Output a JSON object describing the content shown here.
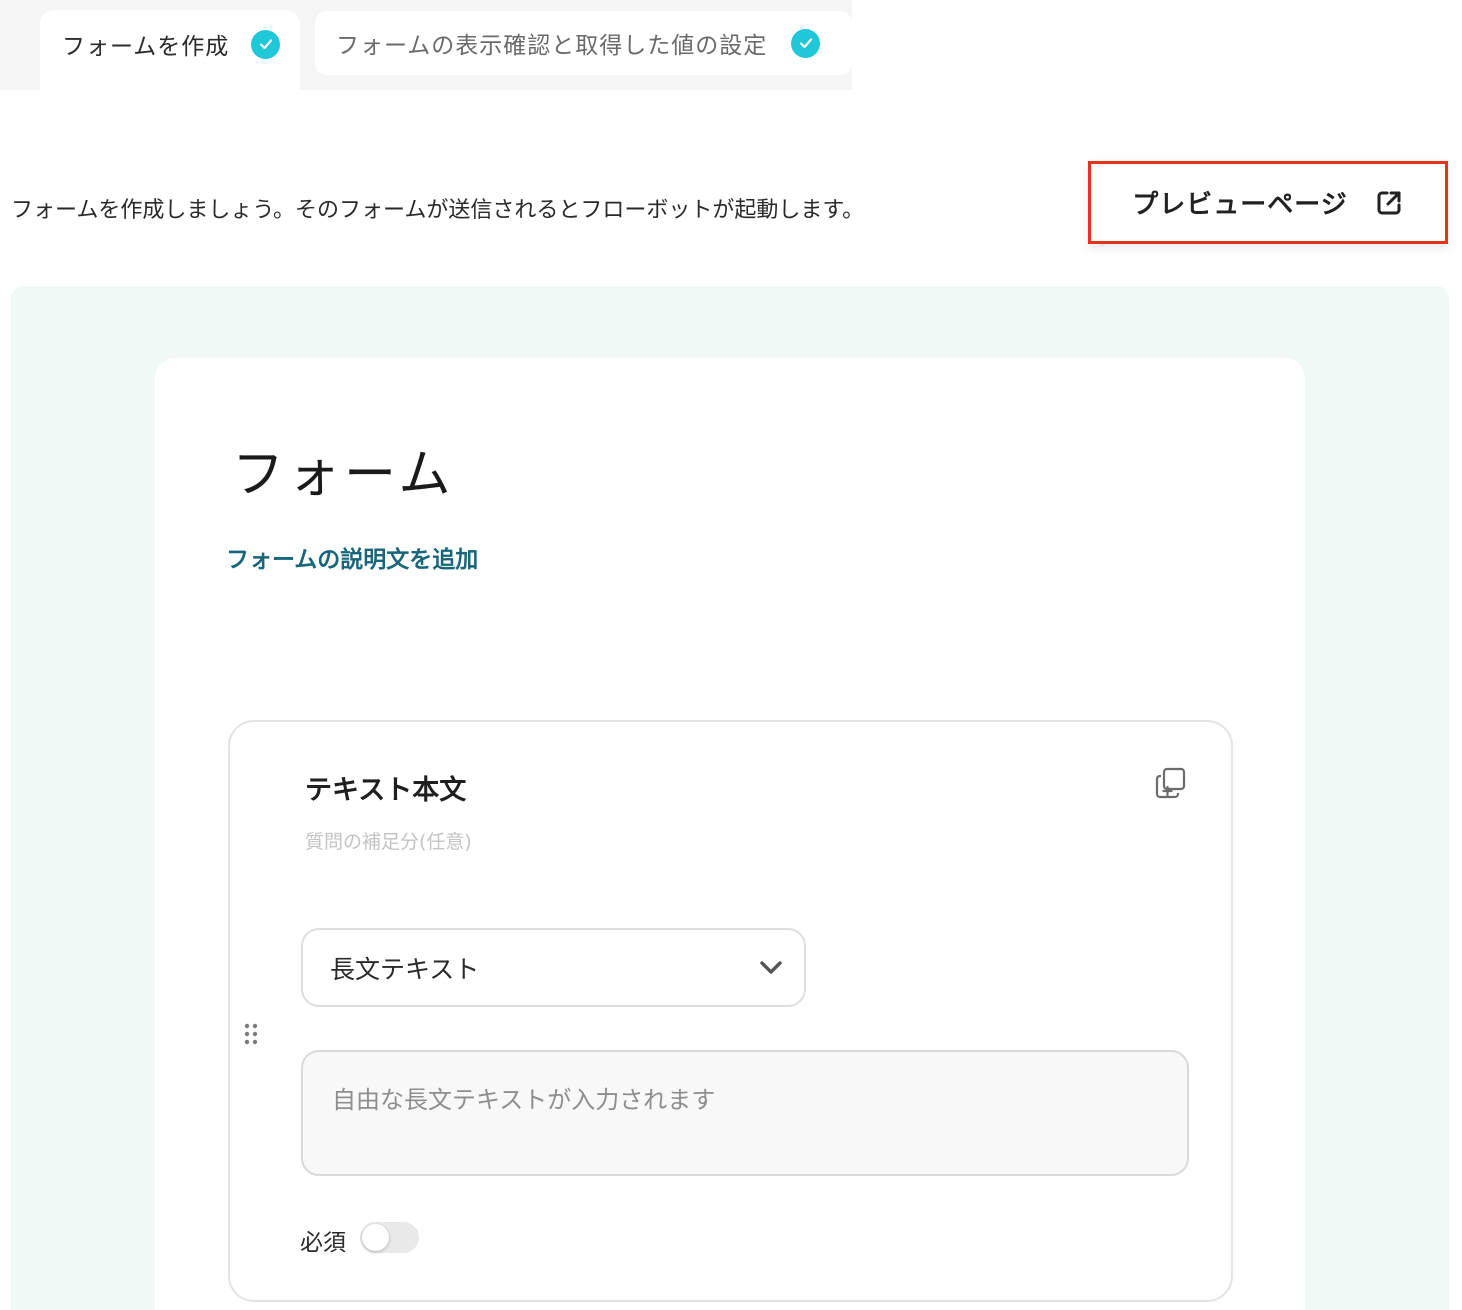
{
  "tabs": [
    {
      "label": "フォームを作成",
      "completed": true,
      "active": true
    },
    {
      "label": "フォームの表示確認と取得した値の設定",
      "completed": true,
      "active": false
    }
  ],
  "intro_text": "フォームを作成しましょう。そのフォームが送信されるとフローボットが起動します。",
  "preview_button": {
    "label": "プレビューページ",
    "icon": "external-link-icon",
    "highlight_color": "#e8321d"
  },
  "form": {
    "title": "フォーム",
    "add_description_link": "フォームの説明文を追加",
    "question": {
      "title": "テキスト本文",
      "subtitle_placeholder": "質問の補足分(任意)",
      "type_select": {
        "value": "長文テキスト"
      },
      "answer_placeholder": "自由な長文テキストが入力されます",
      "required_label": "必須",
      "required": false
    }
  },
  "colors": {
    "accent_check": "#1fc7d8",
    "link": "#17667a",
    "canvas_bg": "#f1f9f7"
  }
}
